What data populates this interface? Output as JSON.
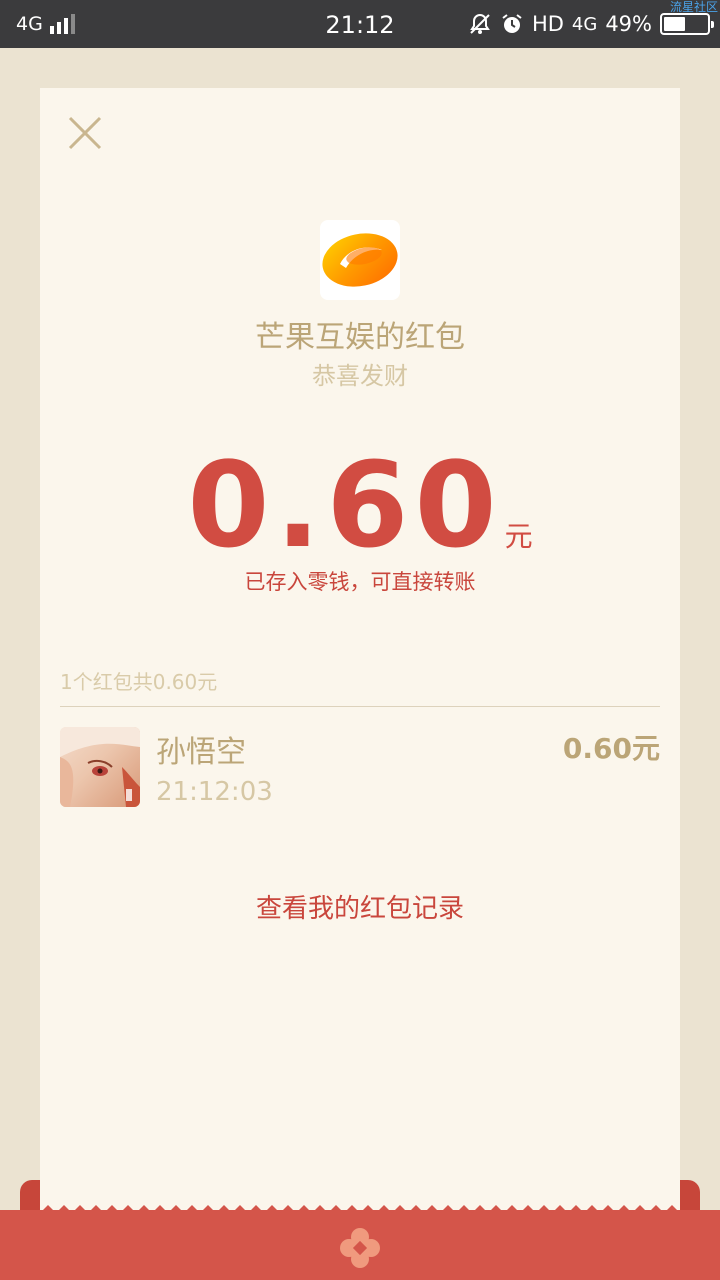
{
  "status_bar": {
    "network": "4G",
    "time": "21:12",
    "hd_label": "HD",
    "data_label": "4G",
    "battery_percent_text": "49%",
    "battery_level": 0.49,
    "watermark": "流星社区"
  },
  "card": {
    "sender_name": "芒果互娱的红包",
    "greeting": "恭喜发财",
    "amount": "0.60",
    "amount_unit": "元",
    "saved_note": "已存入零钱，可直接转账",
    "summary": "1个红包共0.60元",
    "records": [
      {
        "name": "孙悟空",
        "time": "21:12:03",
        "amount": "0.60元"
      }
    ],
    "history_link": "查看我的红包记录"
  },
  "colors": {
    "accent_red": "#d14c42",
    "gold_text": "#bba577",
    "card_bg": "#fbf6ec",
    "page_bg": "#ebe3d1"
  },
  "icons": {
    "close": "close-icon",
    "logo": "mango-tv-logo",
    "envelope_seal": "flower-seal-icon"
  }
}
